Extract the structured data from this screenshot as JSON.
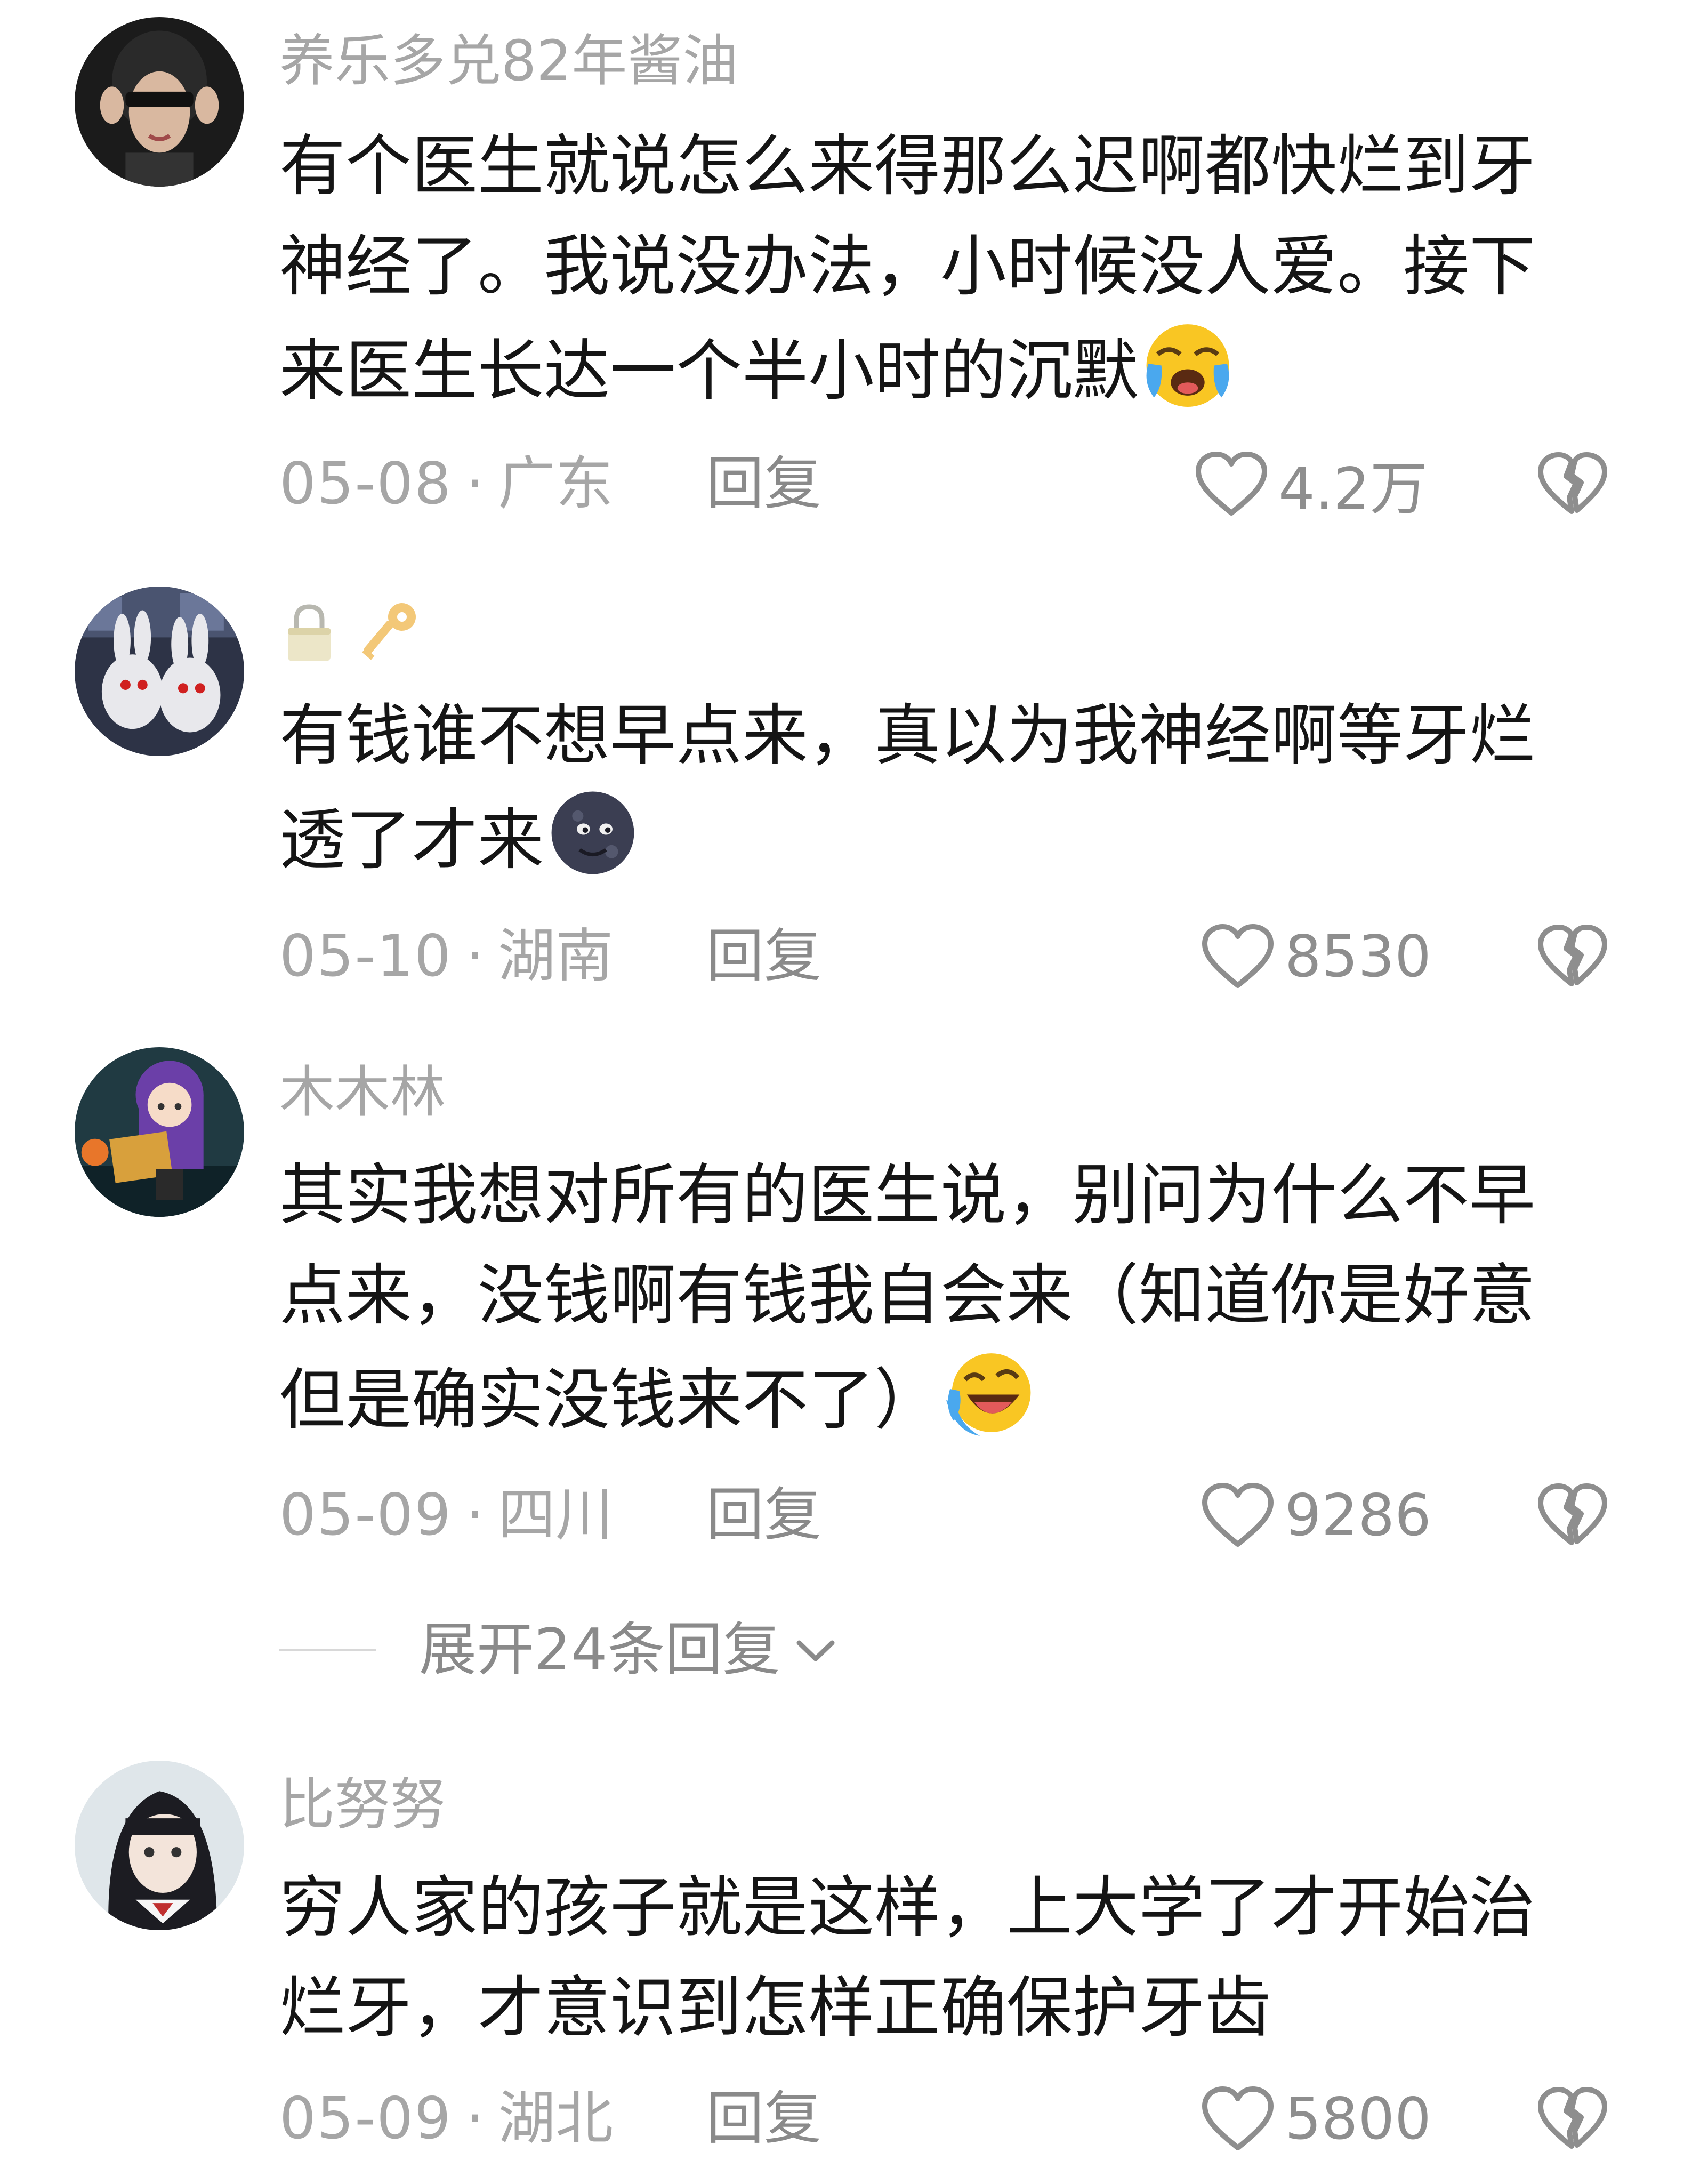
{
  "colors": {
    "text_primary": "#151515",
    "text_secondary": "#a6a6a6",
    "action": "#8a8a8a",
    "background": "#ffffff"
  },
  "comments": [
    {
      "username": "养乐多兑82年酱油",
      "body_lines": [
        "有个医生就说怎么来得那么迟啊都快烂到牙",
        "神经了。我说没办法，小时候没人爱。接下",
        "来医生长达一个半小时的沉默"
      ],
      "emoji": "crying-face",
      "date": "05-08",
      "region": "广东",
      "reply_label": "回复",
      "likes": "4.2万"
    },
    {
      "username_icons": [
        "lock-icon",
        "key-icon"
      ],
      "body_lines": [
        "有钱谁不想早点来，真以为我神经啊等牙烂",
        "透了才来"
      ],
      "emoji": "new-moon-face",
      "date": "05-10",
      "region": "湖南",
      "reply_label": "回复",
      "likes": "8530"
    },
    {
      "username": "木木林",
      "body_lines": [
        "其实我想对所有的医生说，别问为什么不早",
        "点来，没钱啊有钱我自会来（知道你是好意",
        "但是确实没钱来不了）"
      ],
      "emoji": "laughing-tears-face",
      "date": "05-09",
      "region": "四川",
      "reply_label": "回复",
      "likes": "9286",
      "expand_label": "展开24条回复"
    },
    {
      "username": "比努努",
      "body_lines": [
        "穷人家的孩子就是这样，上大学了才开始治",
        "烂牙，才意识到怎样正确保护牙齿"
      ],
      "date": "05-09",
      "region": "湖北",
      "reply_label": "回复",
      "likes": "5800"
    }
  ],
  "meta_separator": "·"
}
